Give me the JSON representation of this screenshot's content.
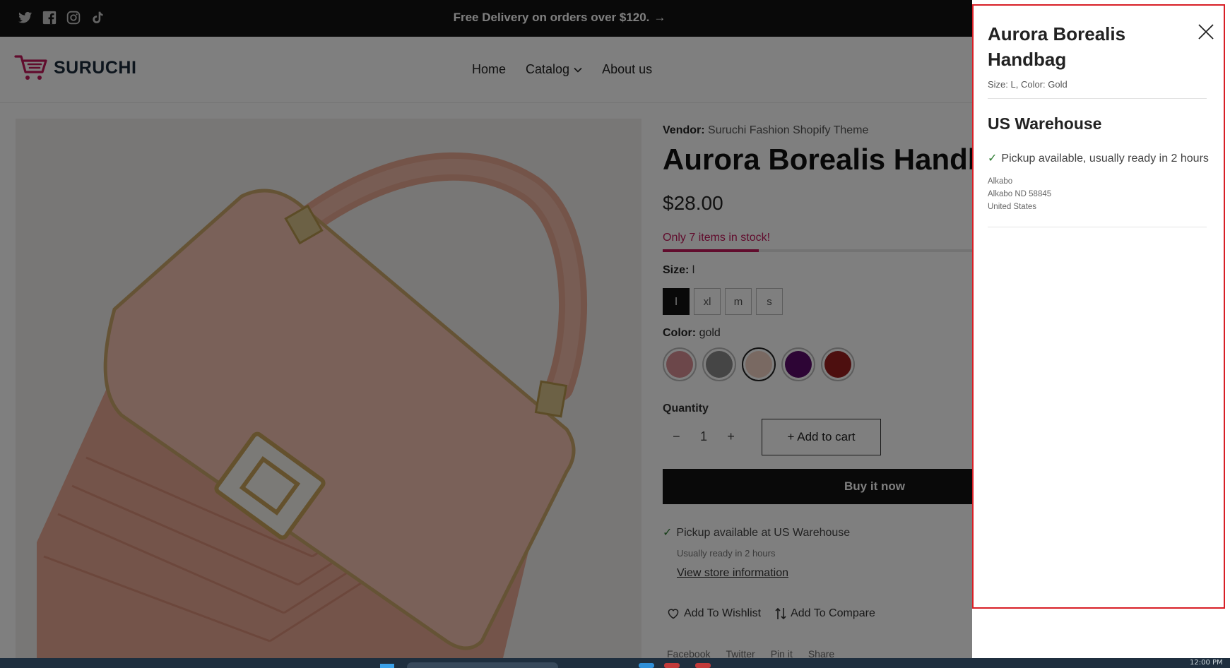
{
  "announcement": {
    "text": "Free Delivery on orders over $120.",
    "arrow": "→"
  },
  "social_icons": [
    "twitter-icon",
    "facebook-icon",
    "instagram-icon",
    "tiktok-icon"
  ],
  "brand": {
    "name": "SURUCHI",
    "accent": "#c2185b"
  },
  "nav": {
    "home": "Home",
    "catalog": "Catalog",
    "about": "About us"
  },
  "product": {
    "vendor_label": "Vendor:",
    "vendor": "Suruchi Fashion Shopify Theme",
    "title": "Aurora Borealis Handba",
    "price": "$28.00",
    "stock_text": "Only 7 items in stock!",
    "stock_fraction": 0.31,
    "size_label": "Size:",
    "size_value": "l",
    "sizes": [
      "l",
      "xl",
      "m",
      "s"
    ],
    "color_label": "Color:",
    "color_value": "gold",
    "color_swatches": [
      "#d98f95",
      "#8a8a8a",
      "#f2d3c4",
      "#5a0a6b",
      "#9b1f1f"
    ],
    "quantity_label": "Quantity",
    "qty_minus": "−",
    "qty_value": "1",
    "qty_plus": "+",
    "add_to_cart": "+ Add to cart",
    "buy_now": "Buy it now",
    "pickup_prefix": "Pickup available at",
    "pickup_location": "US Warehouse",
    "pickup_ready": "Usually ready in 2 hours",
    "view_store": "View store information",
    "wishlist": "Add To Wishlist",
    "compare": "Add To Compare",
    "share": {
      "facebook": "Facebook",
      "twitter": "Twitter",
      "pinterest": "Pin it",
      "share": "Share"
    }
  },
  "drawer": {
    "title": "Aurora Borealis Handbag",
    "variant": "Size: L, Color: Gold",
    "warehouse": "US Warehouse",
    "availability": "Pickup available, usually ready in 2 hours",
    "address_line1": "Alkabo",
    "address_line2": "Alkabo ND 58845",
    "address_line3": "United States"
  },
  "taskbar": {
    "clock": "12:00 PM"
  }
}
